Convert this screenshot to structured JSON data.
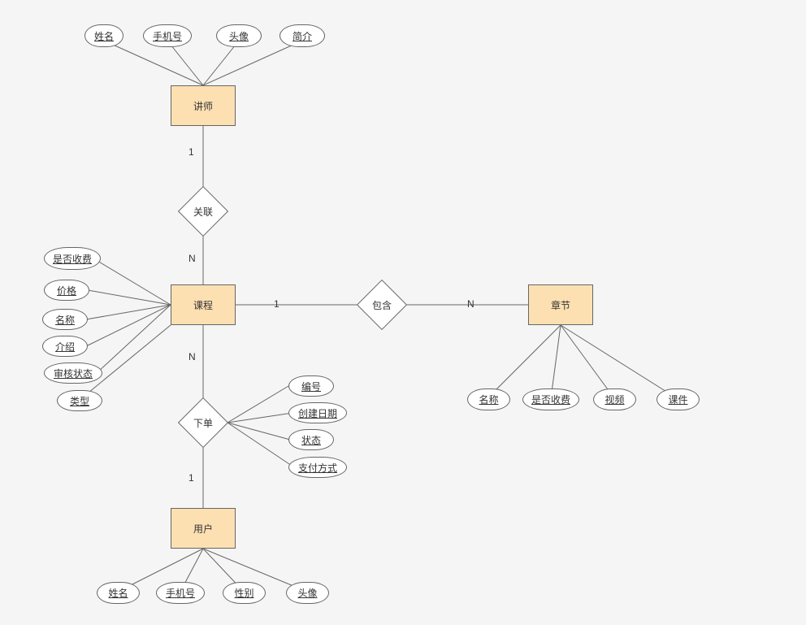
{
  "entities": {
    "lecturer": "讲师",
    "course": "课程",
    "chapter": "章节",
    "user": "用户"
  },
  "relations": {
    "relate": "关联",
    "contain": "包含",
    "order": "下单"
  },
  "card": {
    "lecturer_relate": "1",
    "relate_course": "N",
    "course_contain": "1",
    "contain_chapter": "N",
    "course_order": "N",
    "order_user": "1"
  },
  "attrs": {
    "lecturer": {
      "name": "姓名",
      "phone": "手机号",
      "avatar": "头像",
      "intro": "简介"
    },
    "course": {
      "is_charge": "是否收费",
      "price": "价格",
      "name": "名称",
      "intro": "介绍",
      "audit_status": "审核状态",
      "type": "类型"
    },
    "order": {
      "no": "编号",
      "create_date": "创建日期",
      "status": "状态",
      "pay_method": "支付方式"
    },
    "chapter": {
      "name": "名称",
      "is_charge": "是否收费",
      "video": "视频",
      "courseware": "课件"
    },
    "user": {
      "name": "姓名",
      "phone": "手机号",
      "gender": "性别",
      "avatar": "头像"
    }
  }
}
